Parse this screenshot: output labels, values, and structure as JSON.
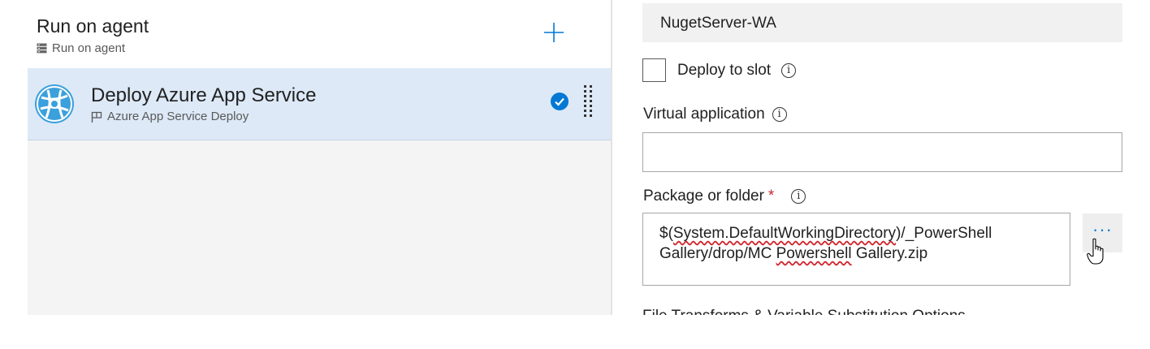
{
  "phase": {
    "title": "Run on agent",
    "subtitle": "Run on agent",
    "add_icon": "plus-icon",
    "server_icon": "server-icon"
  },
  "task": {
    "title": "Deploy Azure App Service",
    "subtitle": "Azure App Service Deploy",
    "icon": "azure-app-service-icon",
    "flag_icon": "flag-icon",
    "status_icon": "checkmark-circle-icon",
    "drag_icon": "drag-handle-icon",
    "selected": true
  },
  "form": {
    "app_service_value": "NugetServer-WA",
    "deploy_to_slot": {
      "label": "Deploy to slot",
      "checked": false
    },
    "virtual_application": {
      "label": "Virtual application",
      "value": ""
    },
    "package": {
      "label": "Package or folder",
      "required_marker": "*",
      "value_line1_prefix": "$(",
      "value_line1_squiggle": "System.DefaultWorkingDirectory",
      "value_line1_suffix": ")/_PowerShell",
      "value_line2_prefix": "Gallery/drop/MC ",
      "value_line2_squiggle": "Powershell",
      "value_line2_suffix": " Gallery.zip",
      "browse_label": "···"
    },
    "info_glyph": "i",
    "next_section_partial": "File Transforms & Variable Substitution Options"
  },
  "colors": {
    "accent": "#0078d4",
    "selected_row": "#dde9f7",
    "required": "#c4262e",
    "panel_bg": "#f4f4f4"
  }
}
